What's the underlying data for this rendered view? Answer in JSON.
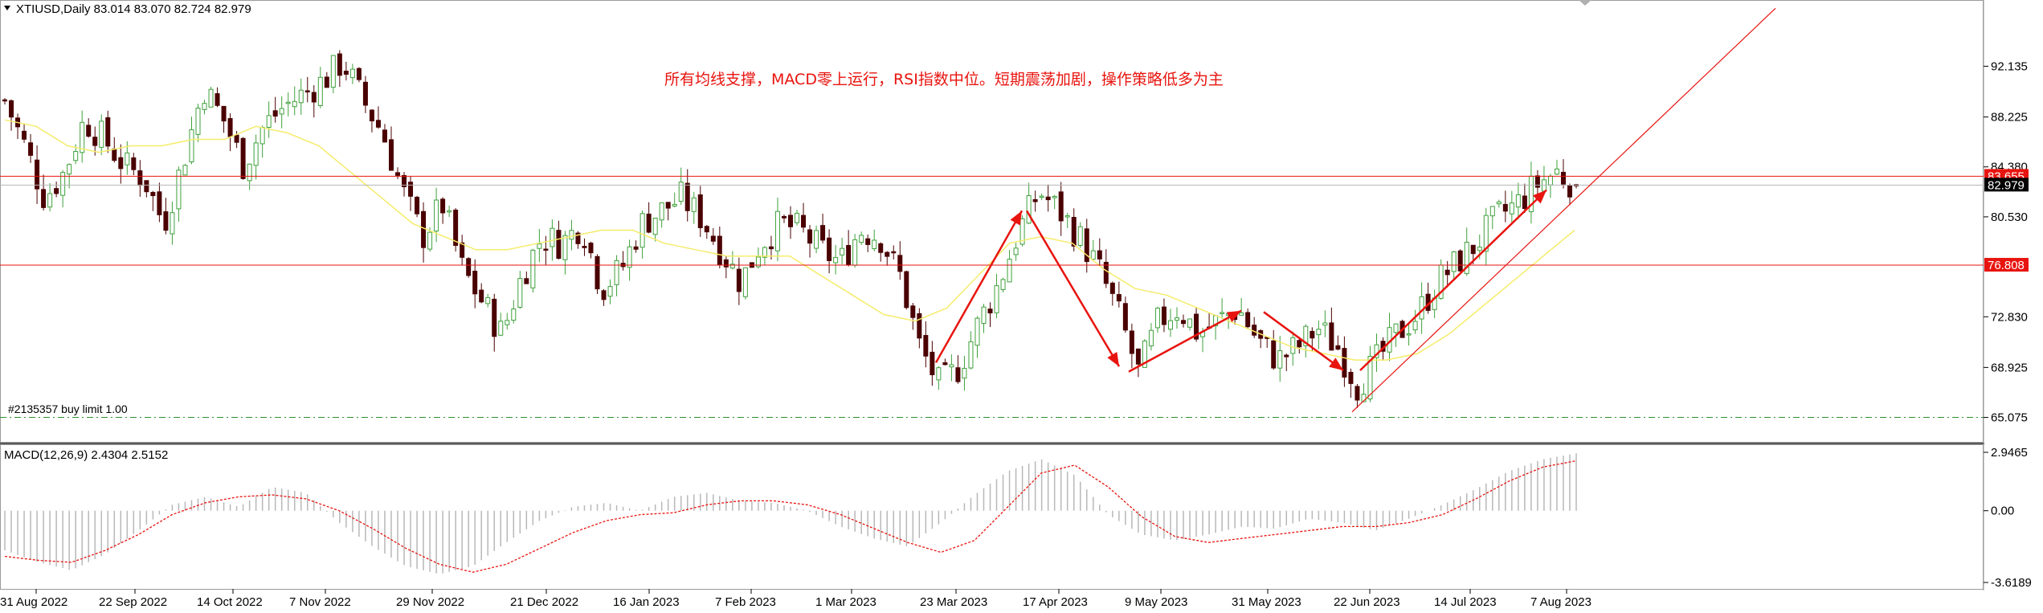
{
  "main_panel": {
    "header": "XTIUSD,Daily  83.014 83.070 82.724 82.979",
    "annotation": "所有均线支撑，MACD零上运行，RSI指数中位。短期震荡加剧，操作策略低多为主",
    "order_label": "#2135357 buy limit 1.00",
    "price_ticks": [
      "92.135",
      "88.225",
      "84.380",
      "80.530",
      "72.830",
      "68.925",
      "65.075"
    ],
    "price_tags": [
      {
        "text": "83.655",
        "color": "#e8140f",
        "value": 83.655
      },
      {
        "text": "82.979",
        "color": "#000000",
        "value": 82.979
      },
      {
        "text": "76.808",
        "color": "#e8140f",
        "value": 76.808
      }
    ]
  },
  "macd_panel": {
    "header": "MACD(12,26,9) 2.4304 2.5152",
    "ticks": [
      "2.9465",
      "0.00",
      "-3.6189"
    ]
  },
  "date_ticks": [
    "31 Aug 2022",
    "22 Sep 2022",
    "14 Oct 2022",
    "7 Nov 2022",
    "29 Nov 2022",
    "21 Dec 2022",
    "16 Jan 2023",
    "7 Feb 2023",
    "1 Mar 2023",
    "23 Mar 2023",
    "17 Apr 2023",
    "9 May 2023",
    "31 May 2023",
    "22 Jun 2023",
    "14 Jul 2023",
    "7 Aug 2023"
  ],
  "colors": {
    "bull": "#3fa13c",
    "bear": "#4a0000",
    "ma": "#f5ec6b",
    "resistance": "#e8140f",
    "arrows": "#e8140f",
    "order_line": "#2f8f2f",
    "macd_hist": "#b8b8b8",
    "macd_signal": "#e8140f"
  },
  "chart_data": [
    {
      "type": "candlestick",
      "symbol": "XTIUSD",
      "timeframe": "Daily",
      "ohlc_last": {
        "open": 83.014,
        "high": 83.07,
        "low": 82.724,
        "close": 82.979
      },
      "ylim": [
        63.5,
        96
      ],
      "x": [
        "31 Aug 2022",
        "22 Sep 2022",
        "14 Oct 2022",
        "7 Nov 2022",
        "29 Nov 2022",
        "21 Dec 2022",
        "16 Jan 2023",
        "7 Feb 2023",
        "1 Mar 2023",
        "23 Mar 2023",
        "17 Apr 2023",
        "9 May 2023",
        "31 May 2023",
        "22 Jun 2023",
        "14 Jul 2023",
        "7 Aug 2023"
      ],
      "close_path": [
        89.5,
        86.0,
        82.0,
        84.0,
        88.0,
        86.5,
        84.5,
        83.5,
        80.0,
        85.0,
        90.5,
        88.0,
        84.5,
        87.5,
        89.0,
        90.0,
        91.0,
        92.5,
        89.5,
        87.0,
        82.5,
        79.0,
        81.5,
        76.5,
        74.0,
        71.5,
        76.0,
        79.0,
        78.5,
        80.0,
        75.0,
        76.5,
        80.0,
        81.0,
        82.0,
        80.5,
        78.0,
        75.5,
        78.5,
        80.0,
        79.5,
        78.0,
        77.0,
        79.5,
        79.0,
        76.0,
        70.5,
        67.5,
        69.0,
        72.5,
        75.5,
        79.5,
        82.5,
        81.0,
        79.0,
        76.5,
        73.0,
        68.5,
        72.5,
        73.5,
        71.5,
        72.5,
        73.5,
        71.0,
        69.5,
        70.5,
        72.0,
        70.5,
        67.5,
        69.5,
        71.5,
        73.0,
        75.5,
        77.0,
        78.5,
        80.5,
        81.5,
        83.0,
        84.0,
        82.979
      ],
      "moving_average": [
        88.0,
        87.5,
        86.0,
        85.5,
        86.0,
        86.0,
        86.5,
        86.5,
        87.5,
        87.0,
        86.0,
        84.0,
        82.0,
        80.0,
        79.0,
        78.0,
        78.0,
        78.5,
        79.0,
        79.5,
        79.5,
        78.5,
        78.0,
        77.5,
        77.5,
        77.5,
        76.0,
        74.5,
        73.0,
        72.5,
        73.5,
        76.0,
        78.5,
        79.0,
        78.5,
        76.5,
        75.0,
        74.5,
        73.5,
        72.5,
        71.5,
        70.5,
        70.0,
        69.5,
        69.5,
        70.0,
        71.5,
        73.5,
        75.5,
        77.5,
        79.5
      ],
      "horizontal_levels": [
        83.655,
        76.808,
        65.075
      ],
      "trendline": {
        "from": [
          "22 Jun 2023",
          65.5
        ],
        "to": [
          "7 Aug 2023",
          96
        ]
      }
    },
    {
      "type": "bar",
      "name": "MACD(12,26,9)",
      "macd": 2.4304,
      "signal": 2.5152,
      "ylim": [
        -3.6189,
        2.9465
      ],
      "histogram_path": [
        -2.0,
        -2.6,
        -3.0,
        -2.2,
        -1.0,
        0.3,
        0.7,
        0.2,
        1.2,
        0.9,
        -0.6,
        -1.8,
        -2.8,
        -3.2,
        -2.8,
        -1.6,
        -0.5,
        0.2,
        0.4,
        0.0,
        0.7,
        0.9,
        0.5,
        0.4,
        0.0,
        -0.8,
        -1.4,
        -1.8,
        -0.6,
        0.8,
        2.0,
        2.6,
        1.8,
        -0.2,
        -1.2,
        -1.5,
        -1.2,
        -0.8,
        -0.9,
        -0.4,
        -0.6,
        -1.0,
        -0.4,
        0.3,
        1.1,
        2.0,
        2.6,
        2.9
      ],
      "signal_path": [
        -2.3,
        -2.5,
        -2.6,
        -2.0,
        -1.2,
        -0.2,
        0.4,
        0.7,
        0.8,
        0.6,
        0.0,
        -0.9,
        -1.9,
        -2.7,
        -3.1,
        -2.7,
        -1.9,
        -1.1,
        -0.5,
        -0.2,
        -0.1,
        0.3,
        0.5,
        0.5,
        0.3,
        -0.2,
        -0.9,
        -1.6,
        -2.1,
        -1.5,
        0.2,
        1.9,
        2.3,
        1.2,
        -0.3,
        -1.3,
        -1.6,
        -1.4,
        -1.2,
        -1.0,
        -0.8,
        -0.8,
        -0.6,
        -0.2,
        0.6,
        1.5,
        2.2,
        2.5152
      ]
    }
  ]
}
